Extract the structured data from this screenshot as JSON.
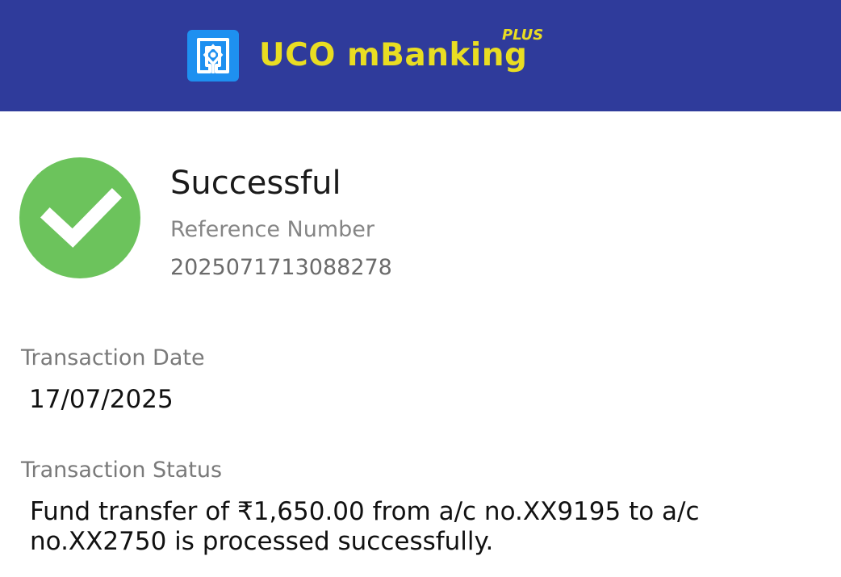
{
  "header": {
    "app_name": "UCO mBanking",
    "app_suffix": "PLUS",
    "background_color": "#2f3b9b",
    "title_color": "#e9dd22",
    "logo_icon": "uco-bank-logo-icon"
  },
  "result": {
    "icon": "check-circle-icon",
    "icon_color": "#6cc35c",
    "title": "Successful",
    "reference_label": "Reference Number",
    "reference_value": "2025071713088278"
  },
  "transaction": {
    "date_label": "Transaction Date",
    "date_value": "17/07/2025",
    "status_label": "Transaction Status",
    "status_message": "Fund transfer of ₹1,650.00 from a/c no.XX9195 to a/c no.XX2750 is processed successfully."
  }
}
